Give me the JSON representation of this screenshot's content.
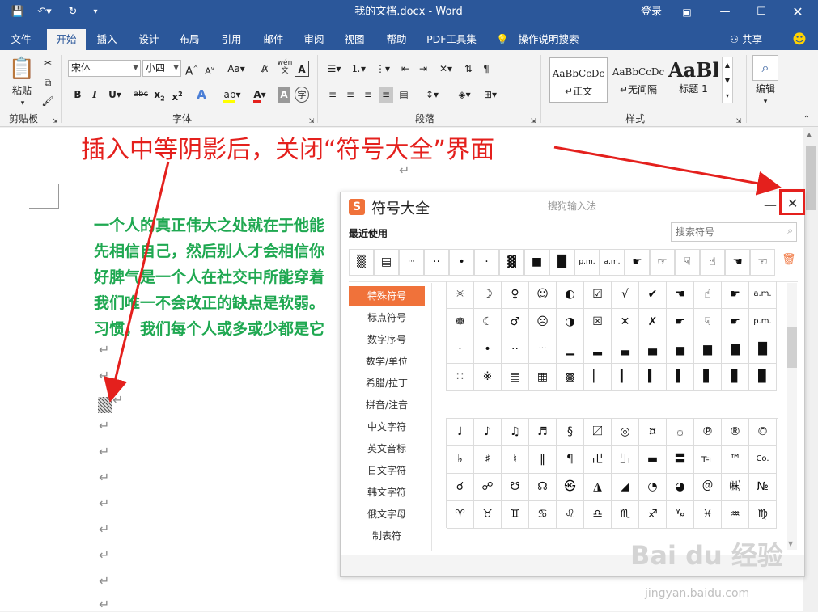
{
  "window": {
    "title": "我的文档.docx  -  Word",
    "login": "登录"
  },
  "tabs": [
    "文件",
    "开始",
    "插入",
    "设计",
    "布局",
    "引用",
    "邮件",
    "审阅",
    "视图",
    "帮助",
    "PDF工具集",
    "操作说明搜索"
  ],
  "share": "共享",
  "ribbon": {
    "clipboard": {
      "paste": "粘贴",
      "label": "剪贴板"
    },
    "font": {
      "name": "宋体",
      "size": "小四",
      "label": "字体"
    },
    "paragraph": {
      "label": "段落"
    },
    "styles": {
      "items": [
        "正文",
        "无间隔",
        "标题 1"
      ],
      "samples": [
        "AaBbCcDc",
        "AaBbCcDc",
        "AaBl"
      ],
      "label": "样式"
    },
    "editing": {
      "label": "编辑"
    }
  },
  "annotation": "插入中等阴影后，关闭“符号大全”界面",
  "document": {
    "paragraphs": [
      "一个人的真正伟大之处就在于他能",
      "先相信自己，然后别人才会相信你",
      "好脾气是一个人在社交中所能穿着",
      "我们唯一不会改正的缺点是软弱。",
      "习惯，我们每个人或多或少都是它"
    ],
    "para_mark": "↵"
  },
  "panel": {
    "title": "符号大全",
    "ime": "搜狗输入法",
    "recent_label": "最近使用",
    "search_placeholder": "搜索符号",
    "recent": [
      "▒",
      "▤",
      "···",
      "··",
      "•",
      "·",
      "▓",
      "■",
      "█",
      "p.m.",
      "a.m.",
      "☛",
      "☞",
      "☟",
      "☝",
      "☚",
      "☜"
    ],
    "categories": [
      "特殊符号",
      "标点符号",
      "数字序号",
      "数学/单位",
      "希腊/拉丁",
      "拼音/注音",
      "中文字符",
      "英文音标",
      "日文字符",
      "韩文字符",
      "俄文字母",
      "制表符"
    ],
    "grid1": [
      [
        "☼",
        "☽",
        "♀",
        "☺",
        "◐",
        "☑",
        "√",
        "✔",
        "☚",
        "☝",
        "☛",
        "a.m."
      ],
      [
        "☸",
        "☾",
        "♂",
        "☹",
        "◑",
        "☒",
        "✕",
        "✗",
        "☛",
        "☟",
        "☛",
        "p.m."
      ],
      [
        "·",
        "•",
        "··",
        "···",
        "▁",
        "▂",
        "▃",
        "▄",
        "▅",
        "▆",
        "▇",
        "█"
      ],
      [
        "∷",
        "※",
        "▤",
        "▦",
        "▩",
        "▏",
        "▎",
        "▍",
        "▌",
        "▋",
        "▊",
        "▉"
      ]
    ],
    "grid2": [
      [
        "♩",
        "♪",
        "♫",
        "♬",
        "§",
        "〼",
        "◎",
        "¤",
        "۞",
        "℗",
        "®",
        "©"
      ],
      [
        "♭",
        "♯",
        "♮",
        "‖",
        "¶",
        "卍",
        "卐",
        "▬",
        "〓",
        "℡",
        "™",
        "Co."
      ],
      [
        "☌",
        "☍",
        "☋",
        "☊",
        "㉿",
        "◮",
        "◪",
        "◔",
        "◕",
        "＠",
        "㈱",
        "№"
      ],
      [
        "♈",
        "♉",
        "♊",
        "♋",
        "♌",
        "♎",
        "♏",
        "♐",
        "♑",
        "♓",
        "♒",
        "♍"
      ]
    ]
  },
  "watermark": {
    "brand": "Bai du 经验",
    "url": "jingyan.baidu.com"
  }
}
